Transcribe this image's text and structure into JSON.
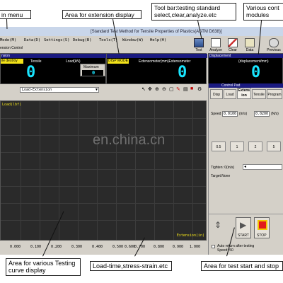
{
  "callouts": {
    "main_menu": "in menu",
    "extension_display": "Area for extension display",
    "toolbar": "Tool bar:testing standard\nselect,clear,analyze.etc",
    "controls": "Various cont\nmodules",
    "curve": "Area for various Testing\ncurve display",
    "load_time": "Load-time,stress-strain.etc",
    "start_stop": "Area for test start and stop"
  },
  "window": {
    "title": "[Standard Test Method for Tensile Properties of Plastics(ASTM D638)]",
    "menu": [
      "Mode(M)",
      "Data(D)",
      "Settings(S)",
      "Debug(B)",
      "Tools(T)",
      "Window(W)",
      "Help(H)"
    ],
    "toolbar": [
      "Test",
      "Analyze",
      "Clear",
      "Data",
      "Previous"
    ],
    "tension_control": "ension Control"
  },
  "panels": {
    "load_title": "nsion",
    "load_mode": "ile destroy",
    "load_tensile": "Tensile",
    "load_unit": "Load(kN)",
    "load_value": "0",
    "maximum_label": "Maximum",
    "maximum_value": "0",
    "disp_mode": "DISP MODE",
    "ext_label": "Extensometer(mm)Extensometer",
    "ext_value": "0",
    "displacement_title": "Displacement",
    "displacement_unit": "(displacement/mm)",
    "displacement_value": "0"
  },
  "curve": {
    "select": "Load-Extension",
    "ylabel": "Load(lbf)",
    "xlabel": "Extension(in)",
    "x_ticks": [
      "0.000",
      "0.100",
      "0.200",
      "0.300",
      "0.400",
      "0.500",
      "0.600",
      "0.700",
      "0.800",
      "0.900",
      "1.000"
    ],
    "watermark": "en.china.cn"
  },
  "control": {
    "title": "Control Pad",
    "tabs": [
      "Disp",
      "Load",
      "Extens\nion",
      "Tensile",
      "Program"
    ],
    "speed_label": "Speed",
    "speed_value": "0.0100",
    "speed_unit": "(in/s)",
    "speed_value2": "0.0200",
    "speed_unit2": "(N/s)",
    "buttons": [
      "0.5",
      "1",
      "2",
      "5"
    ],
    "tighten_label": "Tighten: 0(in/s)",
    "target_label": "Target:None",
    "start": "START",
    "stop": "STOP",
    "auto_return": "Auto return after testing",
    "speed_bottom": "Speed: 50"
  }
}
